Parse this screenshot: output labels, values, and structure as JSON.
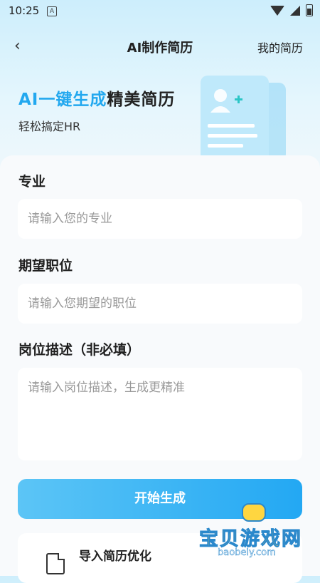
{
  "status_bar": {
    "time": "10:25",
    "notification": "A"
  },
  "nav": {
    "back_symbol": "‹",
    "title": "AI制作简历",
    "right_link": "我的简历"
  },
  "hero": {
    "title_highlight": "AI一键生成",
    "title_rest": "精美简历",
    "subtitle": "轻松搞定HR"
  },
  "form": {
    "major_label": "专业",
    "major_placeholder": "请输入您的专业",
    "position_label": "期望职位",
    "position_placeholder": "请输入您期望的职位",
    "description_label": "岗位描述（非必填）",
    "description_placeholder": "请输入岗位描述，生成更精准"
  },
  "primary_button": "开始生成",
  "import_card": {
    "label": "导入简历优化"
  },
  "watermark": {
    "text": "宝贝游戏网",
    "url": "baobeiy.com"
  },
  "colors": {
    "accent": "#22a8ef",
    "button_start": "#5cc5f6",
    "button_end": "#23a8f3"
  }
}
